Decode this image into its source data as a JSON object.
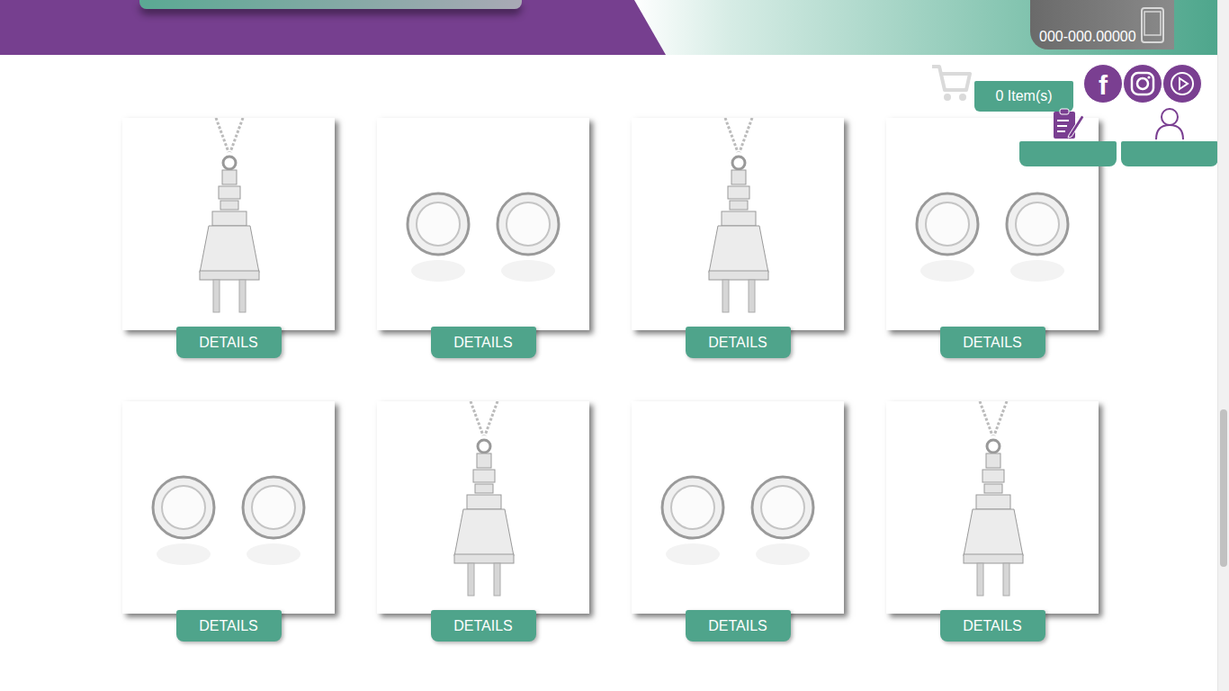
{
  "header": {
    "phone": "000-000.00000"
  },
  "cart": {
    "count_label": "0 Item(s)"
  },
  "social": [
    {
      "kind": "facebook",
      "glyph": "f"
    },
    {
      "kind": "instagram"
    },
    {
      "kind": "youtube"
    }
  ],
  "account_tabs": [
    {
      "kind": "orders"
    },
    {
      "kind": "user"
    }
  ],
  "products": [
    {
      "kind": "pendant",
      "button": "DETAILS"
    },
    {
      "kind": "earrings",
      "button": "DETAILS"
    },
    {
      "kind": "pendant",
      "button": "DETAILS"
    },
    {
      "kind": "earrings",
      "button": "DETAILS"
    },
    {
      "kind": "earrings",
      "button": "DETAILS"
    },
    {
      "kind": "pendant",
      "button": "DETAILS"
    },
    {
      "kind": "earrings",
      "button": "DETAILS"
    },
    {
      "kind": "pendant",
      "button": "DETAILS"
    }
  ]
}
